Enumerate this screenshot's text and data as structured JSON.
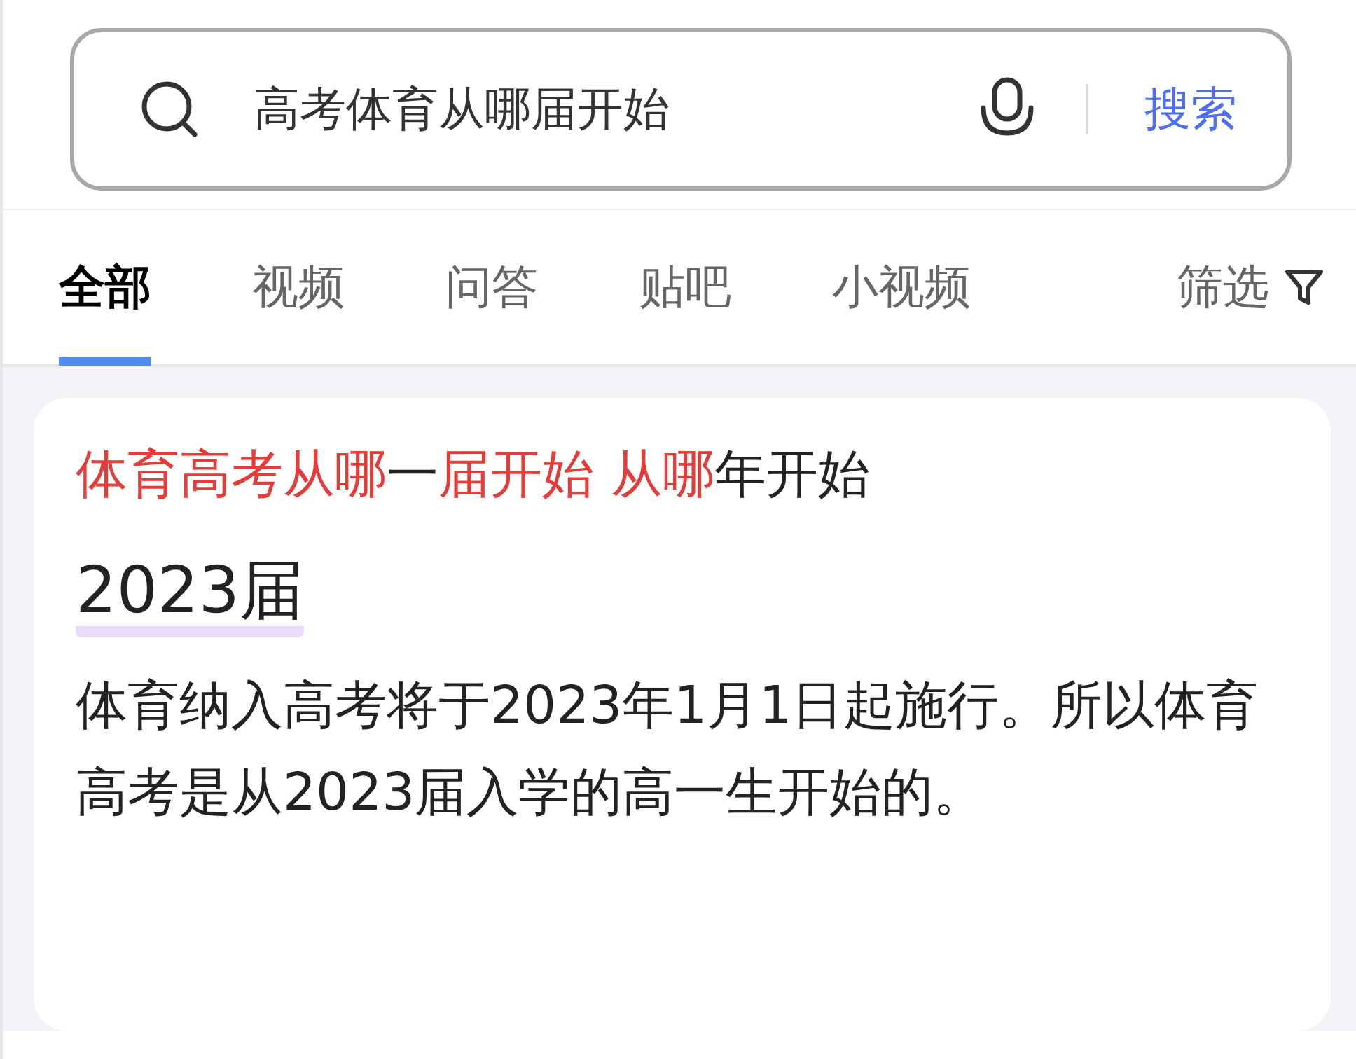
{
  "search": {
    "value": "高考体育从哪届开始",
    "button": "搜索"
  },
  "tabs": [
    {
      "label": "全部",
      "selected": true
    },
    {
      "label": "视频",
      "selected": false
    },
    {
      "label": "问答",
      "selected": false
    },
    {
      "label": "贴吧",
      "selected": false
    },
    {
      "label": "小视频",
      "selected": false
    }
  ],
  "filter": {
    "label": "筛选"
  },
  "result": {
    "title": [
      {
        "text": "体育高考从哪",
        "highlight": true
      },
      {
        "text": "一",
        "highlight": false
      },
      {
        "text": "届开始 从哪",
        "highlight": true
      },
      {
        "text": "年开始",
        "highlight": false
      }
    ],
    "answer": "2023届",
    "body": "体育纳入高考将于2023年1月1日起施行。所以体育高考是从2023届入学的高一生开始的。"
  }
}
